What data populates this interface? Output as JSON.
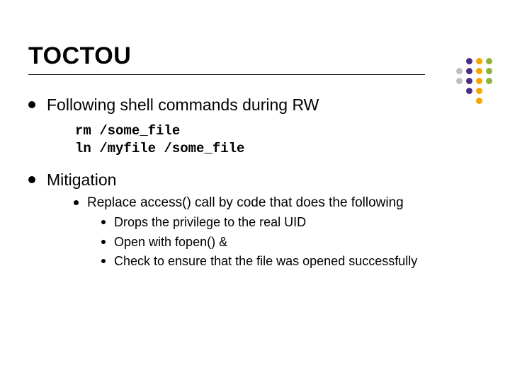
{
  "title": "TOCTOU",
  "items": [
    {
      "text": "Following shell commands during RW",
      "code": "rm /some_file\nln /myfile /some_file"
    },
    {
      "text": "Mitigation",
      "sub": [
        {
          "text": "Replace access() call by code that does the following",
          "sub": [
            {
              "text": "Drops the privilege to the real UID"
            },
            {
              "text": "Open with fopen() &"
            },
            {
              "text": "Check to ensure that the file was opened successfully"
            }
          ]
        }
      ]
    }
  ],
  "dot_colors": {
    "purple": "#4b2e83",
    "orange": "#f7a600",
    "green": "#8fb339",
    "gray": "#bfbfbf"
  },
  "dot_grid": [
    [
      "",
      "purple",
      "orange",
      "green"
    ],
    [
      "gray",
      "purple",
      "orange",
      "green"
    ],
    [
      "gray",
      "purple",
      "orange",
      "green"
    ],
    [
      "",
      "purple",
      "orange",
      ""
    ],
    [
      "",
      "",
      "orange",
      ""
    ]
  ]
}
